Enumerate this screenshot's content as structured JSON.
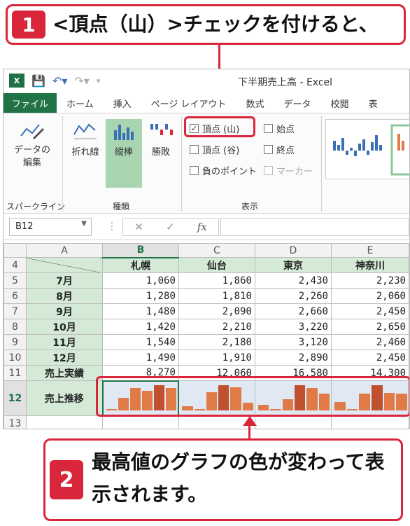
{
  "callout1": {
    "number": "1",
    "text": "<頂点（山）>チェックを付けると、"
  },
  "callout2": {
    "number": "2",
    "text": "最高値のグラフの色が変わって表示されます。"
  },
  "window": {
    "title": "下半期売上高 - Excel"
  },
  "tabs": [
    "ファイル",
    "ホーム",
    "挿入",
    "ページ レイアウト",
    "数式",
    "データ",
    "校閲",
    "表"
  ],
  "ribbon": {
    "edit_data": "データの\n編集",
    "group_sparkline": "スパークライン",
    "line": "折れ線",
    "column": "縦棒",
    "winloss": "勝敗",
    "group_type": "種類",
    "chk_high": "頂点 (山)",
    "chk_low": "頂点 (谷)",
    "chk_negative": "負のポイント",
    "chk_first": "始点",
    "chk_last": "終点",
    "chk_markers": "マーカー",
    "group_show": "表示"
  },
  "formula_bar": {
    "name_box": "B12",
    "fx": "fx"
  },
  "columns": [
    "A",
    "B",
    "C",
    "D",
    "E"
  ],
  "header_row": {
    "row": "4",
    "cities": [
      "札幌",
      "仙台",
      "東京",
      "神奈川"
    ]
  },
  "rows": [
    {
      "row": "5",
      "label": "7月",
      "values": [
        "1,060",
        "1,860",
        "2,430",
        "2,230"
      ]
    },
    {
      "row": "6",
      "label": "8月",
      "values": [
        "1,280",
        "1,810",
        "2,260",
        "2,060"
      ]
    },
    {
      "row": "7",
      "label": "9月",
      "values": [
        "1,480",
        "2,090",
        "2,660",
        "2,450"
      ]
    },
    {
      "row": "8",
      "label": "10月",
      "values": [
        "1,420",
        "2,210",
        "3,220",
        "2,650"
      ]
    },
    {
      "row": "9",
      "label": "11月",
      "values": [
        "1,540",
        "2,180",
        "3,120",
        "2,460"
      ]
    },
    {
      "row": "10",
      "label": "12月",
      "values": [
        "1,490",
        "1,910",
        "2,890",
        "2,450"
      ]
    }
  ],
  "total_row": {
    "row": "11",
    "label": "売上実績",
    "values": [
      "8,270",
      "12,060",
      "16,580",
      "14,300"
    ]
  },
  "spark_row": {
    "row": "12",
    "label": "売上推移"
  },
  "empty_row": {
    "row": "13"
  },
  "spark_data": [
    [
      1060,
      1280,
      1480,
      1420,
      1540,
      1490
    ],
    [
      1860,
      1810,
      2090,
      2210,
      2180,
      1910
    ],
    [
      2430,
      2260,
      2660,
      3220,
      3120,
      2890
    ],
    [
      2230,
      2060,
      2450,
      2650,
      2460,
      2450
    ]
  ],
  "colors": {
    "accent": "#d9263a",
    "excel_green": "#217346",
    "spark_bar": "#e07a47",
    "spark_high": "#c0502e"
  }
}
